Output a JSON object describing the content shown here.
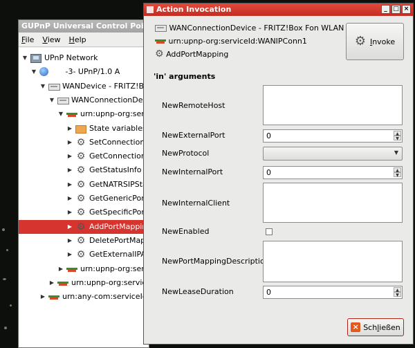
{
  "main_window": {
    "title": "GUPnP Universal Control Point",
    "menu": [
      {
        "accel": "F",
        "rest": "ile"
      },
      {
        "accel": "V",
        "rest": "iew"
      },
      {
        "accel": "H",
        "rest": "elp"
      }
    ],
    "tree": [
      {
        "label": "UPnP Network",
        "icon": "network-icon",
        "arrow": "▼",
        "indent": 0,
        "selected": false
      },
      {
        "label": "     -3-  UPnP/1.0 A",
        "icon": "globe-icon",
        "arrow": "▼",
        "indent": 1,
        "selected": false
      },
      {
        "label": "WANDevice - FRITZ!Box",
        "icon": "device-icon",
        "arrow": "▼",
        "indent": 2,
        "selected": false
      },
      {
        "label": "WANConnectionDevice",
        "icon": "device-icon",
        "arrow": "▼",
        "indent": 3,
        "selected": false
      },
      {
        "label": "urn:upnp-org:service",
        "icon": "service-icon",
        "arrow": "▼",
        "indent": 4,
        "selected": false
      },
      {
        "label": "State variables",
        "icon": "folder-icon",
        "arrow": "▶",
        "indent": 5,
        "selected": false
      },
      {
        "label": "SetConnectionTy",
        "icon": "gear-icon",
        "arrow": "▶",
        "indent": 5,
        "selected": false
      },
      {
        "label": "GetConnectionTy",
        "icon": "gear-icon",
        "arrow": "▶",
        "indent": 5,
        "selected": false
      },
      {
        "label": "GetStatusInfo",
        "icon": "gear-icon",
        "arrow": "▶",
        "indent": 5,
        "selected": false
      },
      {
        "label": "GetNATRSIPStatu",
        "icon": "gear-icon",
        "arrow": "▶",
        "indent": 5,
        "selected": false
      },
      {
        "label": "GetGenericPortM",
        "icon": "gear-icon",
        "arrow": "▶",
        "indent": 5,
        "selected": false
      },
      {
        "label": "GetSpecificPortM",
        "icon": "gear-icon",
        "arrow": "▶",
        "indent": 5,
        "selected": false
      },
      {
        "label": "AddPortMapping",
        "icon": "gear-icon",
        "arrow": "▶",
        "indent": 5,
        "selected": true
      },
      {
        "label": "DeletePortMappi",
        "icon": "gear-icon",
        "arrow": "▶",
        "indent": 5,
        "selected": false
      },
      {
        "label": "GetExternalIPAdd",
        "icon": "gear-icon",
        "arrow": "▶",
        "indent": 5,
        "selected": false
      },
      {
        "label": "urn:upnp-org:servic",
        "icon": "service-icon",
        "arrow": "▶",
        "indent": 4,
        "selected": false
      },
      {
        "label": "urn:upnp-org:serviceId",
        "icon": "service-icon",
        "arrow": "▶",
        "indent": 3,
        "selected": false
      },
      {
        "label": "urn:any-com:serviceId:a",
        "icon": "service-icon",
        "arrow": "▶",
        "indent": 2,
        "selected": false
      }
    ]
  },
  "dialog": {
    "title": "Action Invocation",
    "window_buttons": {
      "minimize": "_",
      "maximize": "□",
      "close": "×"
    },
    "device": "WANConnectionDevice - FRITZ!Box Fon WLAN 7170",
    "service": "urn:upnp-org:serviceId:WANIPConn1",
    "action": "AddPortMapping",
    "invoke": {
      "accel": "I",
      "rest": "nvoke"
    },
    "section_title": "'in' arguments",
    "args": {
      "remote_host": {
        "label": "NewRemoteHost"
      },
      "external_port": {
        "label": "NewExternalPort",
        "value": "0"
      },
      "protocol": {
        "label": "NewProtocol",
        "value": ""
      },
      "internal_port": {
        "label": "NewInternalPort",
        "value": "0"
      },
      "internal_client": {
        "label": "NewInternalClient"
      },
      "enabled": {
        "label": "NewEnabled"
      },
      "description": {
        "label": "NewPortMappingDescription"
      },
      "lease_duration": {
        "label": "NewLeaseDuration",
        "value": "0"
      }
    },
    "close": {
      "pre": "Sch",
      "accel": "l",
      "rest": "ießen"
    }
  },
  "colors": {
    "selection": "#d5342f",
    "dialog_title": "#d23a2e"
  }
}
